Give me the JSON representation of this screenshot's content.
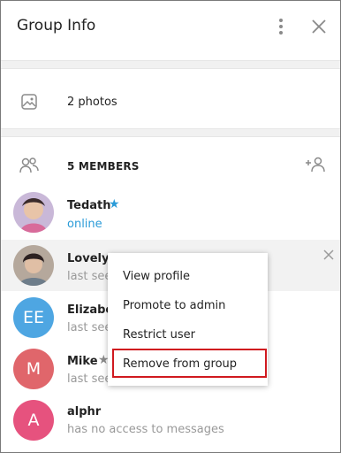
{
  "header": {
    "title": "Group Info"
  },
  "photos": {
    "label": "2 photos"
  },
  "members": {
    "heading": "5 MEMBERS",
    "list": [
      {
        "name": "Tedath",
        "status": "online",
        "avatar": "photo",
        "starred": true
      },
      {
        "name": "Lovely D",
        "status": "last seen",
        "avatar": "photo"
      },
      {
        "name": "Elizabet",
        "status": "last seen",
        "avatar_letters": "EE",
        "avatar_color": "#4ea6e2"
      },
      {
        "name": "Mike",
        "status": "last seen",
        "avatar_letters": "M",
        "avatar_color": "#e0666b",
        "starred": true
      },
      {
        "name": "alphr",
        "status": "has no access to messages",
        "avatar_letters": "A",
        "avatar_color": "#e6527e"
      }
    ]
  },
  "context_menu": {
    "items": [
      "View profile",
      "Promote to admin",
      "Restrict user",
      "Remove from group"
    ],
    "highlighted": "Remove from group"
  },
  "colors": {
    "online": "#2a9bd8",
    "star": "#2a9bd8",
    "highlight_border": "#d0191f"
  }
}
